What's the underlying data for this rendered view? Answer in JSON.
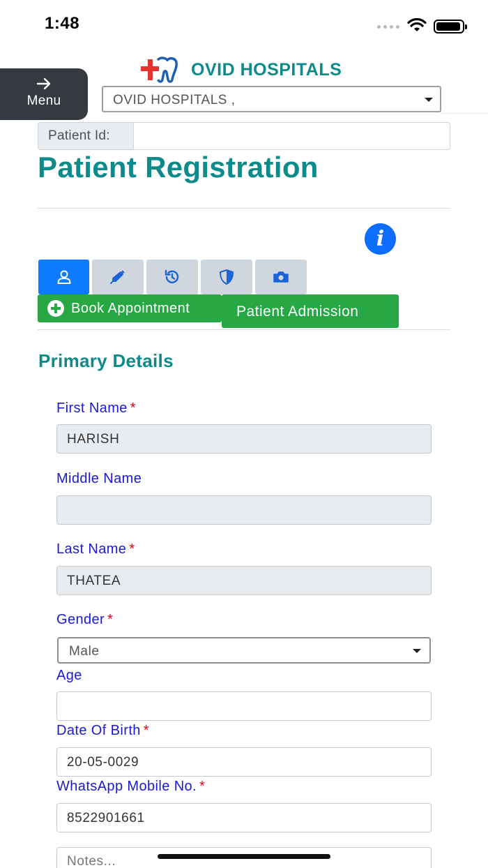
{
  "status_bar": {
    "time": "1:48"
  },
  "header": {
    "brand": "OVID HOSPITALS",
    "menu_label": "Menu",
    "hospital_select_value": "OVID HOSPITALS ,"
  },
  "patient_id": {
    "label": "Patient Id:",
    "value": ""
  },
  "page_title": "Patient Registration",
  "tabs": [
    {
      "icon": "user-icon",
      "active": true
    },
    {
      "icon": "syringe-icon",
      "active": false
    },
    {
      "icon": "history-icon",
      "active": false
    },
    {
      "icon": "shield-icon",
      "active": false
    },
    {
      "icon": "camera-icon",
      "active": false
    }
  ],
  "actions": {
    "book_appointment": "Book Appointment",
    "patient_admission": "Patient Admission"
  },
  "section_title": "Primary Details",
  "form": {
    "first_name": {
      "label": "First Name",
      "required": "*",
      "value": "HARISH"
    },
    "middle_name": {
      "label": "Middle Name",
      "value": ""
    },
    "last_name": {
      "label": "Last Name",
      "required": "*",
      "value": "THATEA"
    },
    "gender": {
      "label": "Gender",
      "required": "*",
      "value": "Male"
    },
    "age": {
      "label": "Age",
      "value": ""
    },
    "dob": {
      "label": "Date Of Birth",
      "required": "*",
      "value": "20-05-0029"
    },
    "whatsapp": {
      "label": "WhatsApp Mobile No.",
      "required": "*",
      "value": "8522901661"
    },
    "notes": {
      "placeholder": "Notes..."
    }
  },
  "colors": {
    "brand": "#0c8b8a",
    "label": "#1a1ad6",
    "primary": "#0d7dfd",
    "success": "#28a745"
  }
}
